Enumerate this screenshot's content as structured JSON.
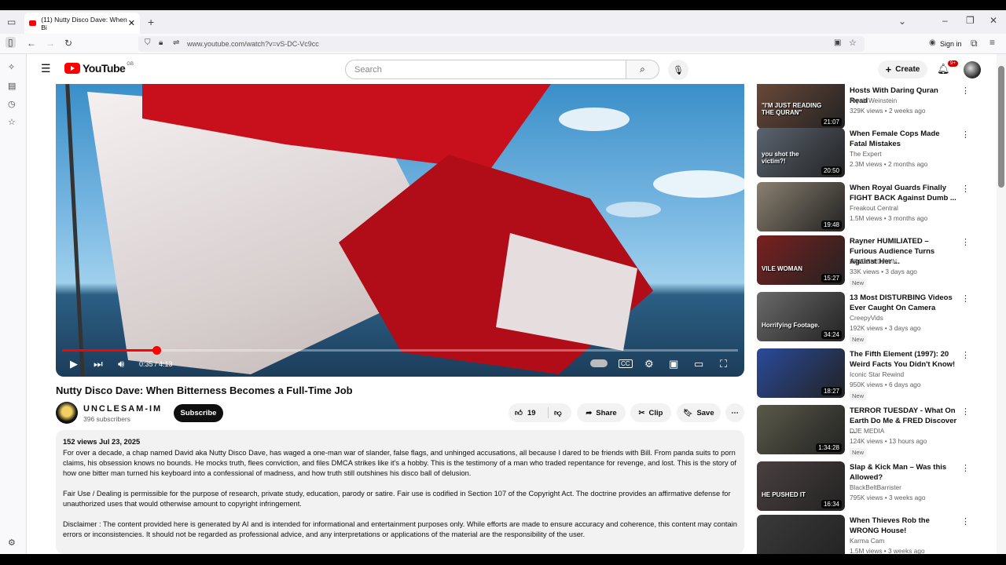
{
  "browser": {
    "tab_title": "(11) Nutty Disco Dave: When Bi",
    "url": "www.youtube.com/watch?v=vS-DC-Vc9cc",
    "signin_label": "Sign in"
  },
  "youtube": {
    "logo": "YouTube",
    "region": "GB",
    "search_placeholder": "Search",
    "create_label": "Create",
    "notif_count": "9+"
  },
  "player": {
    "current_time": "0:35",
    "duration": "4:13",
    "time_display": "0:35 / 4:13",
    "progress": 0.14
  },
  "video": {
    "title": "Nutty Disco Dave: When Bitterness Becomes a Full-Time Job",
    "channel": "UNCLESAM-IM",
    "subscribers": "396 subscribers",
    "subscribe_label": "Subscribe",
    "likes": "19",
    "share_label": "Share",
    "clip_label": "Clip",
    "save_label": "Save",
    "views_date": "152 views  Jul 23, 2025",
    "desc_p1": "For over a decade, a chap named David aka Nutty Disco Dave, has waged a one-man war of slander, false flags, and unhinged accusations, all because I dared to be friends with Bill. From panda suits to porn claims, his obsession knows no bounds. He mocks truth, flees conviction, and files DMCA strikes like it's a hobby. This is the testimony of a man who traded repentance for revenge, and lost. This is the story of how one bitter man turned his keyboard into a confessional of madness, and how truth still outshines his disco ball of delusion.",
    "desc_p2": "Fair Use / Dealing is permissible for the purpose of research, private study, education, parody or satire. Fair use is codified in Section 107 of the Copyright Act. The doctrine provides an affirmative defense for unauthorized uses that would otherwise amount to copyright infringement.",
    "desc_p3": "Disclaimer : The content provided here is generated by AI and is intended for informational and entertainment purposes only. While efforts are made to ensure accuracy and coherence, this content may contain errors or inconsistencies. It should not be regarded as professional advice, and any interpretations or applications of the material are the responsibility of the user."
  },
  "sidebar": [
    {
      "title": "Hosts With Daring Quran Read",
      "channel": "Aryeh Weinstein",
      "meta": "329K views • 2 weeks ago",
      "duration": "21:07",
      "new": "",
      "thumb_text": "\"I'M JUST READING THE QURAN\"",
      "bg": "#6b4a3a"
    },
    {
      "title": "When Female Cops Made Fatal Mistakes",
      "channel": "The Expert",
      "meta": "2.3M views • 2 months ago",
      "duration": "20:50",
      "new": "",
      "thumb_text": "you shot the victim?!",
      "bg": "#5a6470"
    },
    {
      "title": "When Royal Guards Finally FIGHT BACK Against Dumb ...",
      "channel": "Freakout Central",
      "meta": "1.5M views • 3 months ago",
      "duration": "19:48",
      "new": "",
      "thumb_text": "",
      "bg": "#8a8070"
    },
    {
      "title": "Rayner HUMILIATED – Furious Audience Turns Against Her ...",
      "channel": "BRITISH DAWN",
      "meta": "33K views • 3 days ago",
      "duration": "15:27",
      "new": "New",
      "thumb_text": "VILE WOMAN",
      "bg": "#7a2020"
    },
    {
      "title": "13 Most DISTURBING Videos Ever Caught On Camera",
      "channel": "CreepyVids",
      "meta": "192K views • 3 days ago",
      "duration": "34:24",
      "new": "New",
      "thumb_text": "Horrifying Footage.",
      "bg": "#6a6a6a"
    },
    {
      "title": "The Fifth Element (1997): 20 Weird Facts You Didn't Know!",
      "channel": "Iconic Star Rewind",
      "meta": "950K views • 6 days ago",
      "duration": "18:27",
      "new": "New",
      "thumb_text": "",
      "bg": "#2a4a9a"
    },
    {
      "title": "TERROR TUESDAY - What On Earth Do Me & FRED Discover ...",
      "channel": "DJE MEDIA",
      "meta": "124K views • 13 hours ago",
      "duration": "1:34:28",
      "new": "New",
      "thumb_text": "",
      "bg": "#5a5a4a"
    },
    {
      "title": "Slap & Kick Man – Was this Allowed?",
      "channel": "BlackBeltBarrister",
      "meta": "795K views • 3 weeks ago",
      "duration": "16:34",
      "new": "",
      "thumb_text": "HE PUSHED IT",
      "bg": "#4a4040"
    },
    {
      "title": "When Thieves Rob the WRONG House!",
      "channel": "Karma Cam",
      "meta": "1.5M views • 3 weeks ago",
      "duration": "",
      "new": "",
      "thumb_text": "",
      "bg": "#3a3a3a"
    }
  ]
}
